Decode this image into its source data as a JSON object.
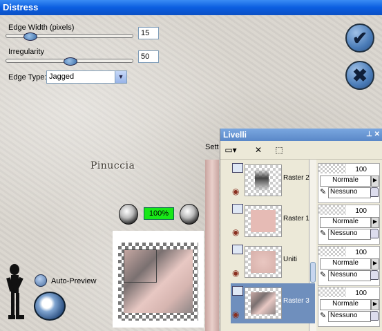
{
  "window": {
    "title": "Distress"
  },
  "controls": {
    "edge_width_label": "Edge Width (pixels)",
    "edge_width_value": "15",
    "edge_width_level": 0.15,
    "irregularity_label": "Irregularity",
    "irregularity_value": "50",
    "irregularity_level": 0.5,
    "edge_type_label": "Edge Type:",
    "edge_type_value": "Jagged"
  },
  "preview": {
    "zoom": "100%",
    "auto_preview_label": "Auto-Preview"
  },
  "watermark": "Pinuccia",
  "layers_panel": {
    "title": "Livelli",
    "sett_label": "Sett",
    "layers": [
      {
        "name": "Raster 2",
        "opacity": "100",
        "blend": "Normale",
        "mask": "Nessuno",
        "selected": false
      },
      {
        "name": "Raster 1",
        "opacity": "100",
        "blend": "Normale",
        "mask": "Nessuno",
        "selected": false
      },
      {
        "name": "Uniti",
        "opacity": "100",
        "blend": "Normale",
        "mask": "Nessuno",
        "selected": false
      },
      {
        "name": "Raster 3",
        "opacity": "100",
        "blend": "Normale",
        "mask": "Nessuno",
        "selected": true
      }
    ]
  },
  "colors": {
    "accent": "#0b5ee0",
    "zoom_bg": "#18e818",
    "selected_layer": "#6f8fbd"
  }
}
